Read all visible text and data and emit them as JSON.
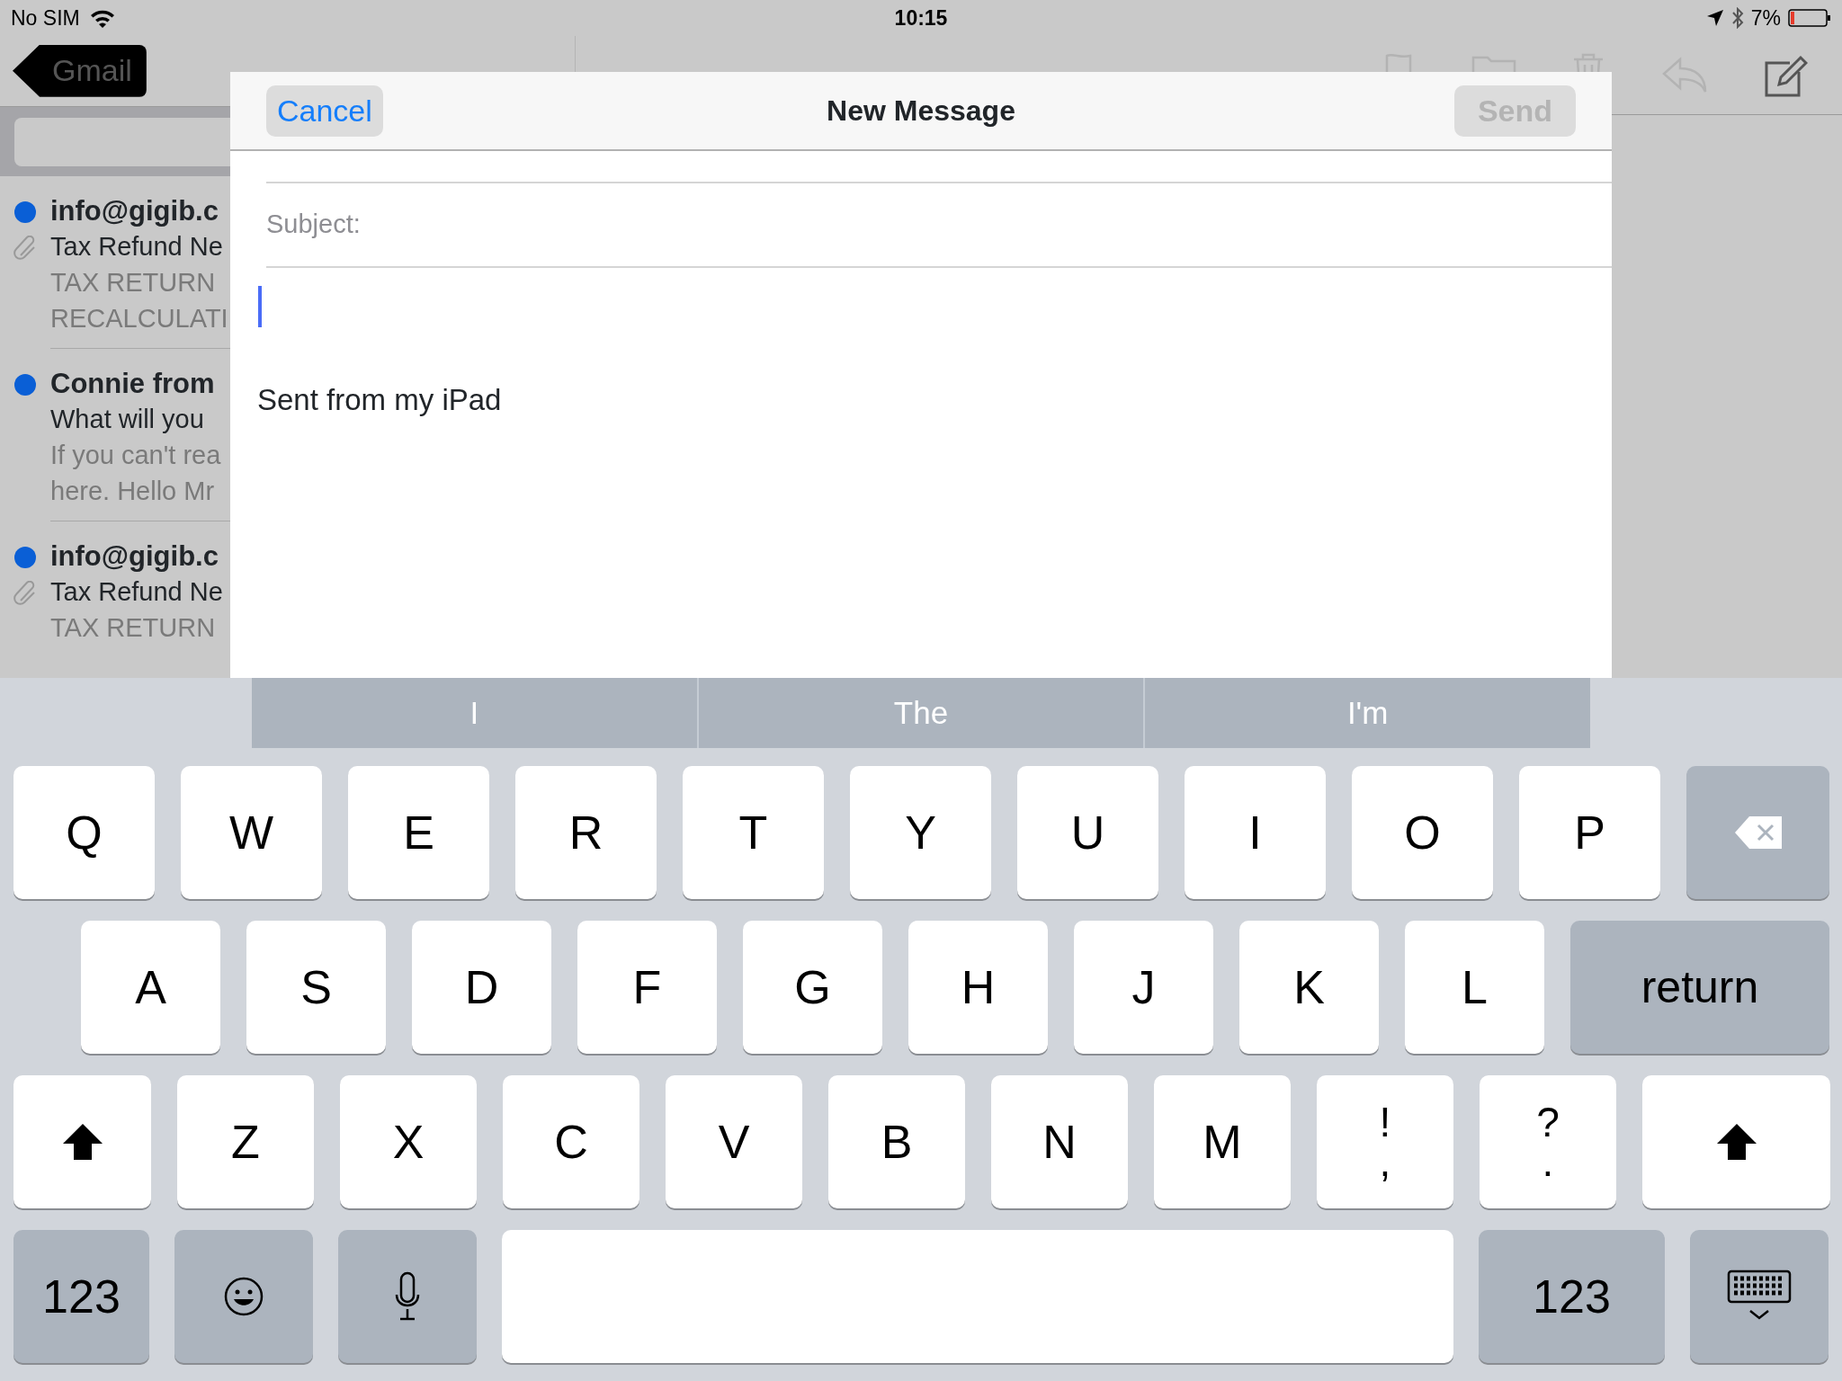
{
  "status_bar": {
    "carrier": "No SIM",
    "time": "10:15",
    "battery": "7%"
  },
  "mail_list": {
    "back_button": "Gmail",
    "messages": [
      {
        "sender": "info@gigib.c",
        "subject": "Tax Refund Ne",
        "preview_lines": [
          "TAX RETURN",
          "RECALCULATI"
        ],
        "unread": true,
        "attachment": true
      },
      {
        "sender": "Connie from",
        "subject": "What will you",
        "preview_lines": [
          "If you can't rea",
          "here. Hello Mr"
        ],
        "unread": true,
        "attachment": false
      },
      {
        "sender": "info@gigib.c",
        "subject": "Tax Refund Ne",
        "preview_lines": [
          "TAX RETURN"
        ],
        "unread": true,
        "attachment": true
      }
    ]
  },
  "compose": {
    "title": "New Message",
    "cancel": "Cancel",
    "send": {
      "label": "Send",
      "disabled": true
    },
    "subject_label": "Subject:",
    "signature": "Sent from my iPad"
  },
  "keyboard": {
    "suggestions": [
      "I",
      "The",
      "I'm"
    ],
    "rows": [
      {
        "keys": [
          {
            "kind": "letter",
            "label": "Q"
          },
          {
            "kind": "letter",
            "label": "W"
          },
          {
            "kind": "letter",
            "label": "E"
          },
          {
            "kind": "letter",
            "label": "R"
          },
          {
            "kind": "letter",
            "label": "T"
          },
          {
            "kind": "letter",
            "label": "Y"
          },
          {
            "kind": "letter",
            "label": "U"
          },
          {
            "kind": "letter",
            "label": "I"
          },
          {
            "kind": "letter",
            "label": "O"
          },
          {
            "kind": "letter",
            "label": "P"
          },
          {
            "kind": "backspace"
          }
        ]
      },
      {
        "keys": [
          {
            "kind": "letter",
            "label": "A"
          },
          {
            "kind": "letter",
            "label": "S"
          },
          {
            "kind": "letter",
            "label": "D"
          },
          {
            "kind": "letter",
            "label": "F"
          },
          {
            "kind": "letter",
            "label": "G"
          },
          {
            "kind": "letter",
            "label": "H"
          },
          {
            "kind": "letter",
            "label": "J"
          },
          {
            "kind": "letter",
            "label": "K"
          },
          {
            "kind": "letter",
            "label": "L"
          },
          {
            "kind": "return",
            "label": "return"
          }
        ]
      },
      {
        "keys": [
          {
            "kind": "shift"
          },
          {
            "kind": "letter",
            "label": "Z"
          },
          {
            "kind": "letter",
            "label": "X"
          },
          {
            "kind": "letter",
            "label": "C"
          },
          {
            "kind": "letter",
            "label": "V"
          },
          {
            "kind": "letter",
            "label": "B"
          },
          {
            "kind": "letter",
            "label": "N"
          },
          {
            "kind": "letter",
            "label": "M"
          },
          {
            "kind": "punct",
            "top": "!",
            "bottom": ","
          },
          {
            "kind": "punct",
            "top": "?",
            "bottom": "."
          },
          {
            "kind": "shift"
          }
        ]
      },
      {
        "keys": [
          {
            "kind": "numbers",
            "label": "123"
          },
          {
            "kind": "emoji"
          },
          {
            "kind": "mic"
          },
          {
            "kind": "space"
          },
          {
            "kind": "numbers",
            "label": "123"
          },
          {
            "kind": "hide"
          }
        ]
      }
    ]
  }
}
